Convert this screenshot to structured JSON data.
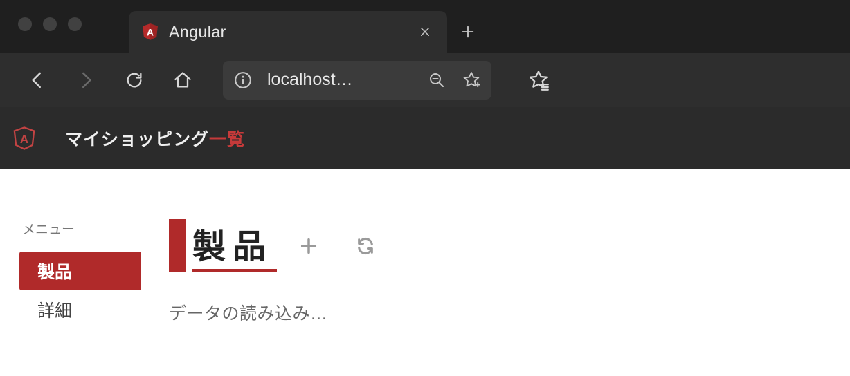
{
  "browser": {
    "tab_title": "Angular",
    "url_display": "localhost…"
  },
  "app": {
    "header": {
      "title_part1": "マイショッピング",
      "title_part2": "一覧"
    },
    "sidebar": {
      "menu_label": "メニュー",
      "items": [
        {
          "label": "製品",
          "active": true
        },
        {
          "label": "詳細",
          "active": false
        }
      ]
    },
    "main": {
      "page_title": "製品",
      "loading_text": "データの読み込み…"
    }
  },
  "colors": {
    "accent": "#b02a2a",
    "chrome_bg": "#1f1f1f",
    "toolbar_bg": "#2e2e2e"
  }
}
